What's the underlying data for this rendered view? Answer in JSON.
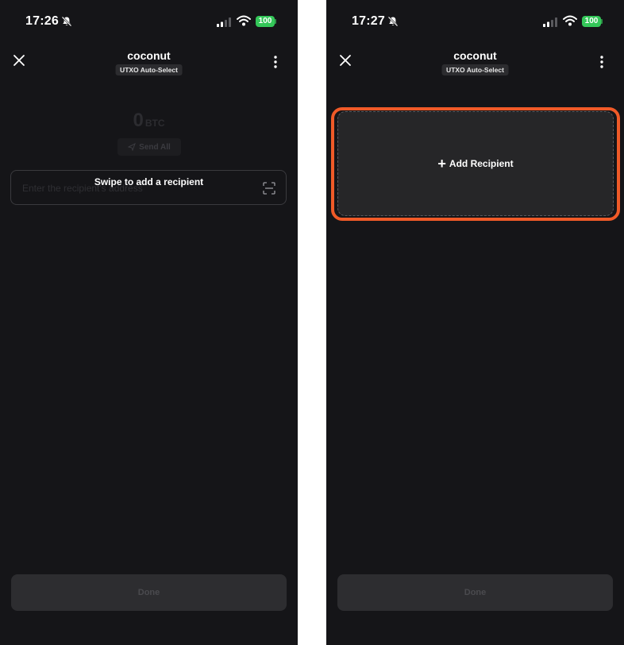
{
  "screens": [
    {
      "status_bar": {
        "time": "17:26",
        "battery": "100"
      },
      "header": {
        "title": "coconut",
        "badge": "UTXO Auto-Select"
      },
      "amount": {
        "value": "0",
        "unit": "BTC"
      },
      "send_all_label": "Send All",
      "address_placeholder": "Enter the recipient's address",
      "swipe_hint": "Swipe to add a recipient",
      "done_label": "Done"
    },
    {
      "status_bar": {
        "time": "17:27",
        "battery": "100"
      },
      "header": {
        "title": "coconut",
        "badge": "UTXO Auto-Select"
      },
      "add_recipient": {
        "icon": "+",
        "label": "Add Recipient"
      },
      "done_label": "Done"
    }
  ],
  "colors": {
    "background": "#151518",
    "battery": "#34c759",
    "highlight": "#f05a28",
    "card": "#262628",
    "button": "#2d2d30"
  },
  "icons": [
    "close-icon",
    "more-vertical-icon",
    "bell-slash-icon",
    "signal-icon",
    "wifi-icon",
    "battery-icon",
    "send-icon",
    "scan-icon",
    "plus-icon"
  ]
}
